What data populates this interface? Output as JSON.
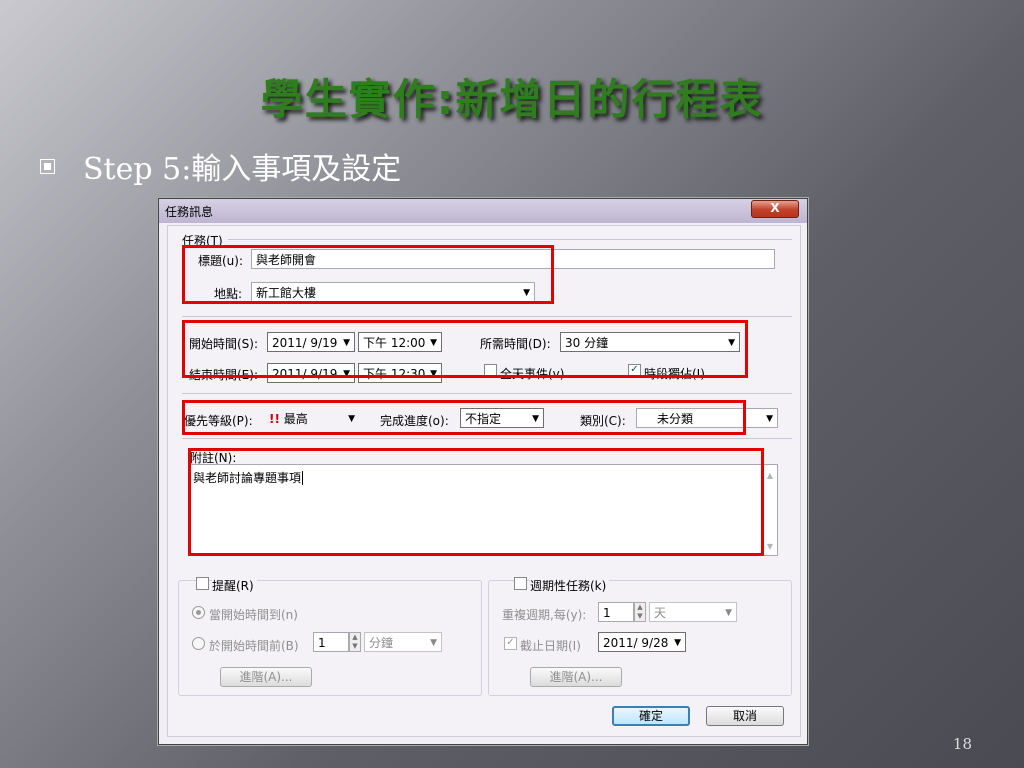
{
  "slide": {
    "title": "學生實作:新增日的行程表",
    "bullet": "Step 5:輸入事項及設定",
    "page_number": "18"
  },
  "dialog": {
    "title": "任務訊息",
    "close_label": "X",
    "task_group_label": "任務(T)",
    "subject_label": "標題(u):",
    "subject_value": "與老師開會",
    "location_label": "地點:",
    "location_value": "新工館大樓",
    "start_label": "開始時間(S):",
    "start_date": "2011/ 9/19",
    "start_time": "下午 12:00",
    "end_label": "結束時間(E):",
    "end_date": "2011/ 9/19",
    "end_time": "下午 12:30",
    "duration_label": "所需時間(D):",
    "duration_value": "30 分鐘",
    "all_day_label": "全天事件(v)",
    "all_day_checked": false,
    "time_estimate_label": "時段獨佔(I)",
    "time_estimate_checked": true,
    "priority_label": "優先等級(P):",
    "priority_mark": "!!",
    "priority_value": "最高",
    "progress_label": "完成進度(o):",
    "progress_value": "不指定",
    "category_label": "類別(C):",
    "category_value": "未分類",
    "notes_label": "附註(N):",
    "notes_value": "與老師討論專題事項",
    "reminder": {
      "label": "提醒(R)",
      "checked": false,
      "option_on_start": "當開始時間到(n)",
      "option_before": "於開始時間前(B)",
      "before_amount": "1",
      "before_unit": "分鐘",
      "advanced_label": "進階(A)..."
    },
    "recurrence": {
      "label": "週期性任務(k)",
      "checked": false,
      "repeat_label": "重複週期,每(y):",
      "repeat_amount": "1",
      "repeat_unit": "天",
      "end_date_label": "截止日期(I)",
      "end_date_value": "2011/ 9/28",
      "advanced_label": "進階(A)..."
    },
    "ok_label": "確定",
    "cancel_label": "取消"
  },
  "colors": {
    "title_green": "#2f7d1f",
    "highlight_red": "#e30000",
    "close_red": "#c0412a"
  }
}
